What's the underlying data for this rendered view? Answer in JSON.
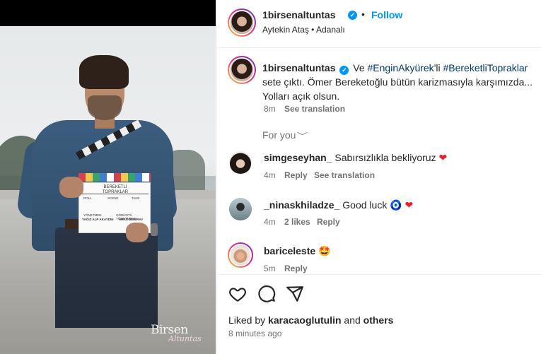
{
  "post": {
    "author": "1birsenaltuntas",
    "follow_label": "Follow",
    "separator": "•",
    "location": "Aytekin Ataş • Adanalı"
  },
  "photo": {
    "watermark_line1": "Birsen",
    "watermark_line2": "Altuntas",
    "clapper_title": "BEREKETLİ TOPRAKLAR",
    "clapper_roll": "ROLL",
    "clapper_scene": "SCENE",
    "clapper_take": "TAKE",
    "clapper_director_label": "YÖNETMEN",
    "clapper_director": "YAĞIZ ALP AKAYDIN",
    "clapper_dop_label": "GÖRÜNTÜ YÖNETMENİ",
    "clapper_dop": "ARAS DEMİRAY"
  },
  "caption": {
    "username": "1birsenaltuntas",
    "text_before": "Ve ",
    "hashtag1": "#EnginAkyürek",
    "text_mid1": "'li ",
    "hashtag2": "#BereketliTopraklar",
    "text_after": " sete çıktı. Ömer Bereketoğlu bütün karizmasıyla karşımızda... Yolları açık olsun.",
    "time": "8m",
    "see_translation": "See translation"
  },
  "for_you": {
    "label": "For you",
    "chevron": "﹀"
  },
  "comments": [
    {
      "username": "simgeseyhan_",
      "text": "Sabırsızlıkla bekliyoruz",
      "emoji": "❤",
      "time": "4m",
      "likes": "",
      "reply": "Reply",
      "translate": "See translation"
    },
    {
      "username": "_ninaskhiladze_",
      "text": "Good luck",
      "emoji": "🧿 ❤",
      "time": "4m",
      "likes": "2 likes",
      "reply": "Reply",
      "translate": ""
    },
    {
      "username": "bariceleste",
      "text": "",
      "emoji": "🤩",
      "time": "5m",
      "likes": "",
      "reply": "Reply",
      "translate": ""
    }
  ],
  "footer": {
    "liked_prefix": "Liked by ",
    "liked_user": "karacaoglutulin",
    "liked_and": " and ",
    "liked_others": "others",
    "ago": "8 minutes ago"
  },
  "icons": [
    "verified-badge-icon",
    "heart-icon",
    "comment-icon",
    "share-icon",
    "chevron-down-icon"
  ],
  "colors": {
    "accent": "#0095f6",
    "hashtag": "#00376b",
    "muted": "#737373",
    "heart": "#ed1c2e"
  }
}
